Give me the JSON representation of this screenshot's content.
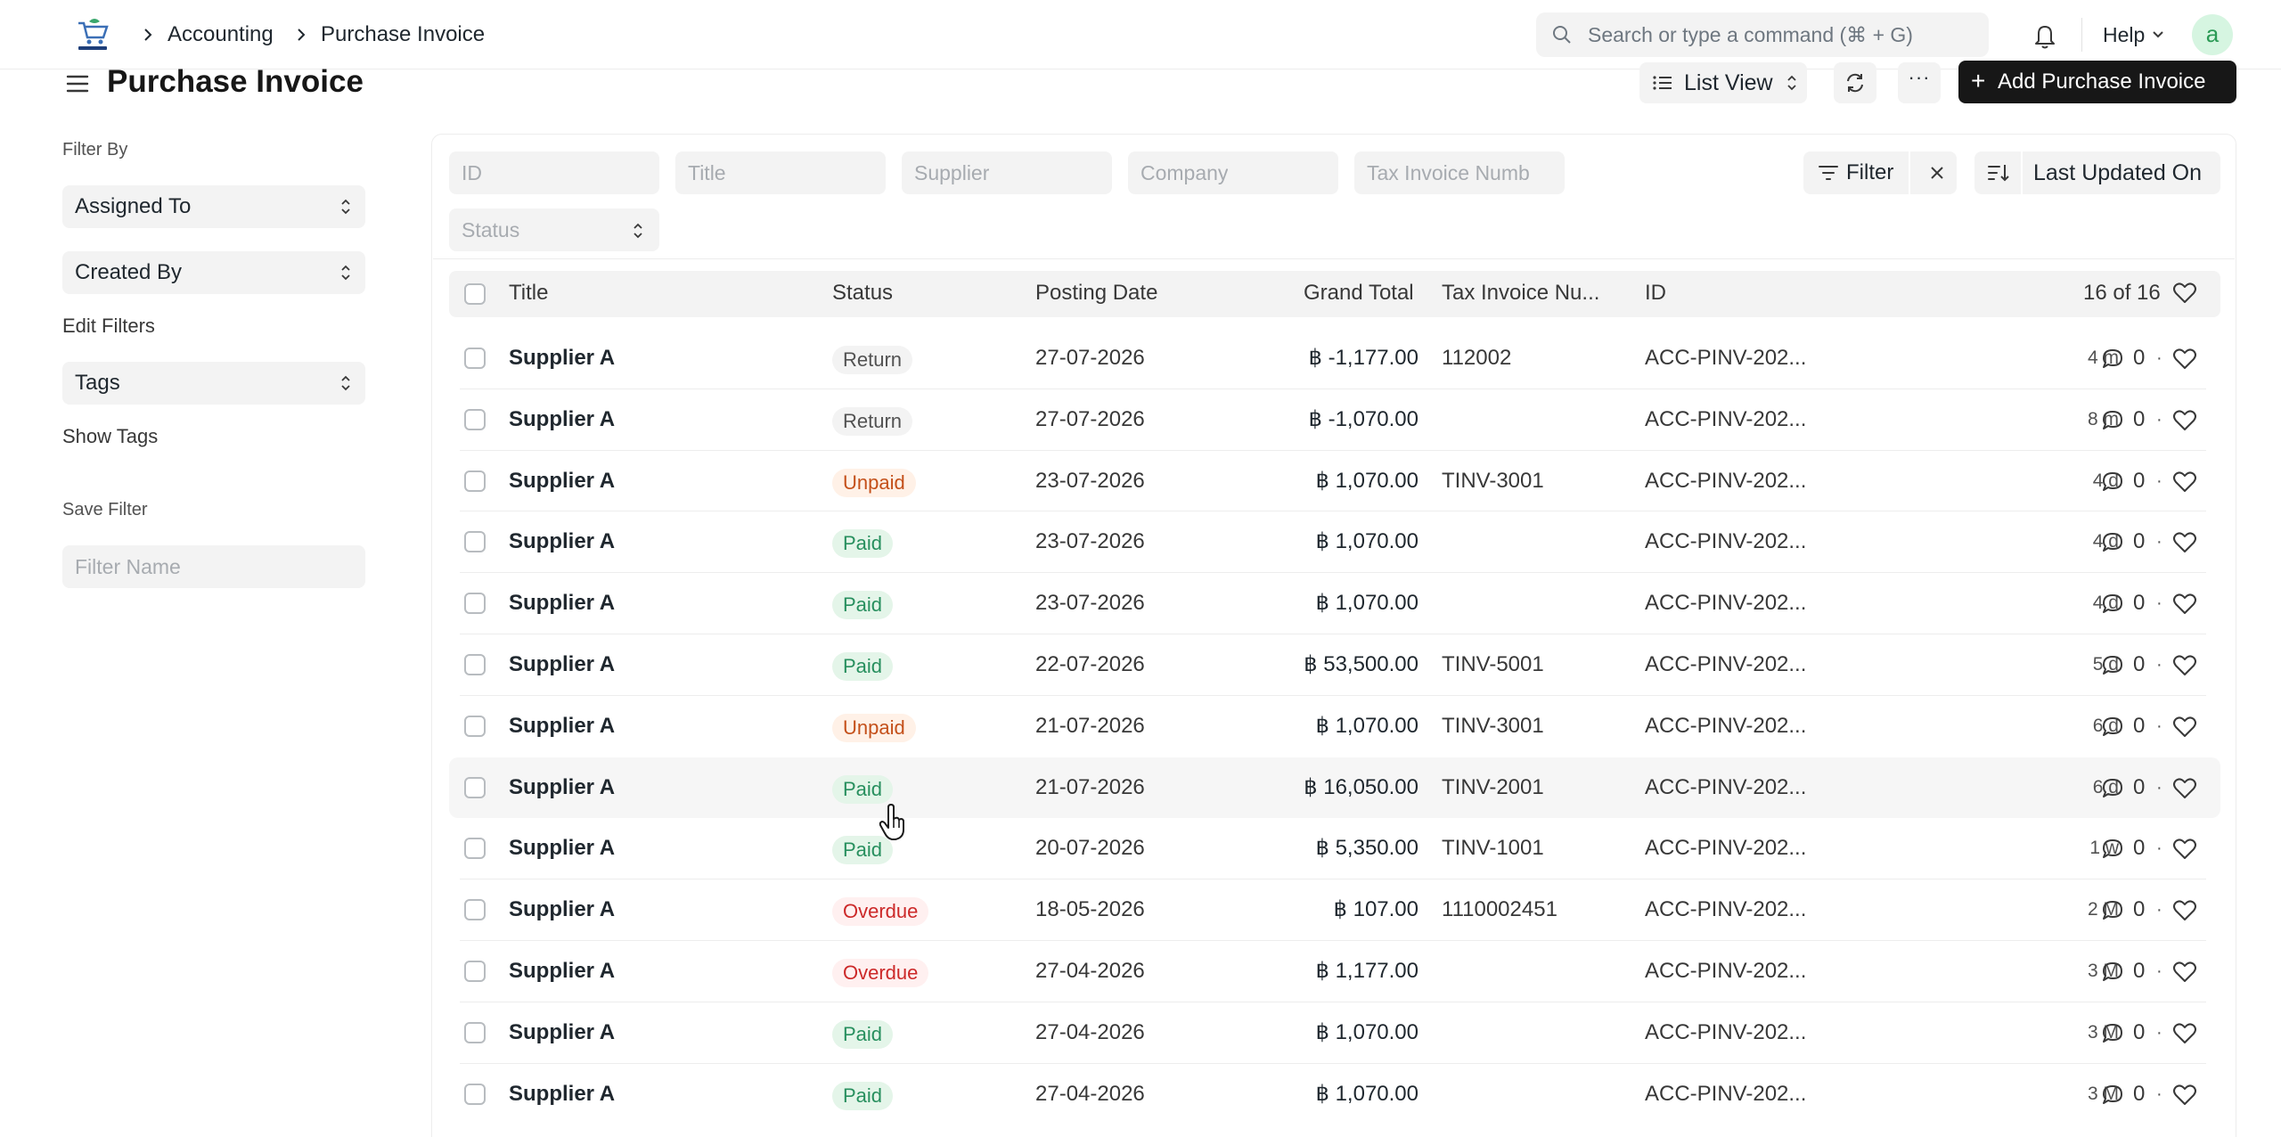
{
  "colors": {
    "primary_button": "#171717",
    "paid": "#278f5e",
    "unpaid": "#c4501a",
    "overdue": "#cc2929",
    "return": "#525252"
  },
  "navbar": {
    "logo": "Super Retail",
    "breadcrumbs": [
      "Accounting",
      "Purchase Invoice"
    ],
    "search_placeholder": "Search or type a command (⌘ + G)",
    "help_label": "Help",
    "avatar_initial": "a"
  },
  "header": {
    "title": "Purchase Invoice",
    "view_label": "List View",
    "more_label": "···",
    "add_plus": "+",
    "add_label": "Add Purchase Invoice"
  },
  "sidebar": {
    "filter_by": "Filter By",
    "assigned_to": "Assigned To",
    "created_by": "Created By",
    "edit_filters": "Edit Filters",
    "tags": "Tags",
    "show_tags": "Show Tags",
    "save_filter": "Save Filter",
    "filter_name_placeholder": "Filter Name"
  },
  "filters": {
    "id": "ID",
    "title": "Title",
    "supplier": "Supplier",
    "company": "Company",
    "tax_invoice": "Tax Invoice Numb",
    "status": "Status",
    "filter_label": "Filter",
    "sort_label": "Last Updated On"
  },
  "table": {
    "columns": {
      "title": "Title",
      "status": "Status",
      "posting_date": "Posting Date",
      "grand_total": "Grand Total",
      "tax_invoice": "Tax Invoice Nu...",
      "id": "ID"
    },
    "count": "16 of 16",
    "rows": [
      {
        "title": "Supplier A",
        "status": "Return",
        "status_kind": "return",
        "date": "27-07-2026",
        "total": "฿ -1,177.00",
        "tax": "112002",
        "id": "ACC-PINV-202...",
        "modified": "4 m",
        "comments": "0"
      },
      {
        "title": "Supplier A",
        "status": "Return",
        "status_kind": "return",
        "date": "27-07-2026",
        "total": "฿ -1,070.00",
        "tax": "",
        "id": "ACC-PINV-202...",
        "modified": "8 m",
        "comments": "0"
      },
      {
        "title": "Supplier A",
        "status": "Unpaid",
        "status_kind": "unpaid",
        "date": "23-07-2026",
        "total": "฿ 1,070.00",
        "tax": "TINV-3001",
        "id": "ACC-PINV-202...",
        "modified": "4 d",
        "comments": "0"
      },
      {
        "title": "Supplier A",
        "status": "Paid",
        "status_kind": "paid",
        "date": "23-07-2026",
        "total": "฿ 1,070.00",
        "tax": "",
        "id": "ACC-PINV-202...",
        "modified": "4 d",
        "comments": "0"
      },
      {
        "title": "Supplier A",
        "status": "Paid",
        "status_kind": "paid",
        "date": "23-07-2026",
        "total": "฿ 1,070.00",
        "tax": "",
        "id": "ACC-PINV-202...",
        "modified": "4 d",
        "comments": "0"
      },
      {
        "title": "Supplier A",
        "status": "Paid",
        "status_kind": "paid",
        "date": "22-07-2026",
        "total": "฿ 53,500.00",
        "tax": "TINV-5001",
        "id": "ACC-PINV-202...",
        "modified": "5 d",
        "comments": "0"
      },
      {
        "title": "Supplier A",
        "status": "Unpaid",
        "status_kind": "unpaid",
        "date": "21-07-2026",
        "total": "฿ 1,070.00",
        "tax": "TINV-3001",
        "id": "ACC-PINV-202...",
        "modified": "6 d",
        "comments": "0"
      },
      {
        "title": "Supplier A",
        "status": "Paid",
        "status_kind": "paid",
        "date": "21-07-2026",
        "total": "฿ 16,050.00",
        "tax": "TINV-2001",
        "id": "ACC-PINV-202...",
        "modified": "6 d",
        "comments": "0"
      },
      {
        "title": "Supplier A",
        "status": "Paid",
        "status_kind": "paid",
        "date": "20-07-2026",
        "total": "฿ 5,350.00",
        "tax": "TINV-1001",
        "id": "ACC-PINV-202...",
        "modified": "1 w",
        "comments": "0"
      },
      {
        "title": "Supplier A",
        "status": "Overdue",
        "status_kind": "overdue",
        "date": "18-05-2026",
        "total": "฿ 107.00",
        "tax": "1110002451",
        "id": "ACC-PINV-202...",
        "modified": "2 M",
        "comments": "0"
      },
      {
        "title": "Supplier A",
        "status": "Overdue",
        "status_kind": "overdue",
        "date": "27-04-2026",
        "total": "฿ 1,177.00",
        "tax": "",
        "id": "ACC-PINV-202...",
        "modified": "3 M",
        "comments": "0"
      },
      {
        "title": "Supplier A",
        "status": "Paid",
        "status_kind": "paid",
        "date": "27-04-2026",
        "total": "฿ 1,070.00",
        "tax": "",
        "id": "ACC-PINV-202...",
        "modified": "3 M",
        "comments": "0"
      },
      {
        "title": "Supplier A",
        "status": "Paid",
        "status_kind": "paid",
        "date": "27-04-2026",
        "total": "฿ 1,070.00",
        "tax": "",
        "id": "ACC-PINV-202...",
        "modified": "3 M",
        "comments": "0"
      }
    ]
  }
}
